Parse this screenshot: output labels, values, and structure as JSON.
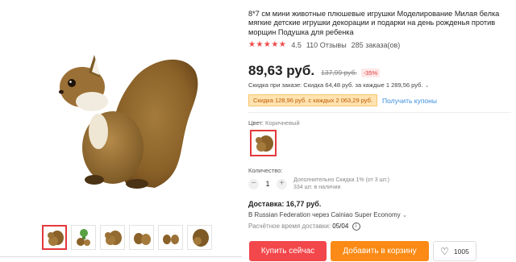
{
  "product": {
    "title": "8*7 см мини животные плюшевые игрушки Моделирование Милая белка мягкие детские игрушки декорации и подарки на день рожденья против морщин Подушка для ребенка",
    "rating": "4.5",
    "reviews": "110 Отзывы",
    "orders": "285 заказа(ов)"
  },
  "price": {
    "current": "89,63 руб.",
    "old": "137,99 руб.",
    "discount_badge": "-35%"
  },
  "order_discount": "Скидка при заказе: Скидка 64,48 руб. за каждые 1 289,56 руб.",
  "coupon": {
    "label": "Скидка 128,96 руб. с каждых 2 063,29 руб.",
    "get_coupons": "Получить купоны"
  },
  "color": {
    "label": "Цвет:",
    "value": "Коричневый"
  },
  "quantity": {
    "label": "Количество:",
    "value": "1",
    "extra_discount": "Дополнительно Скидка 1% (от 3 шт.)",
    "stock": "334 шт. в наличии"
  },
  "delivery": {
    "price": "Доставка: 16,77 руб.",
    "via": "В Russian Federation через Cainiao Super Economy",
    "eta_label": "Расчётное время доставки:",
    "eta_date": "05/04"
  },
  "actions": {
    "buy_now": "Купить сейчас",
    "add_to_cart": "Добавить в корзину",
    "wishlist_count": "1005"
  },
  "icons": {
    "chevron": "chevron-down-icon",
    "info": "info-icon",
    "heart": "heart-icon"
  },
  "colors": {
    "accent_red": "#f2474b",
    "accent_orange": "#fb8b16",
    "star": "#f04a4a",
    "link": "#3a8dde"
  }
}
